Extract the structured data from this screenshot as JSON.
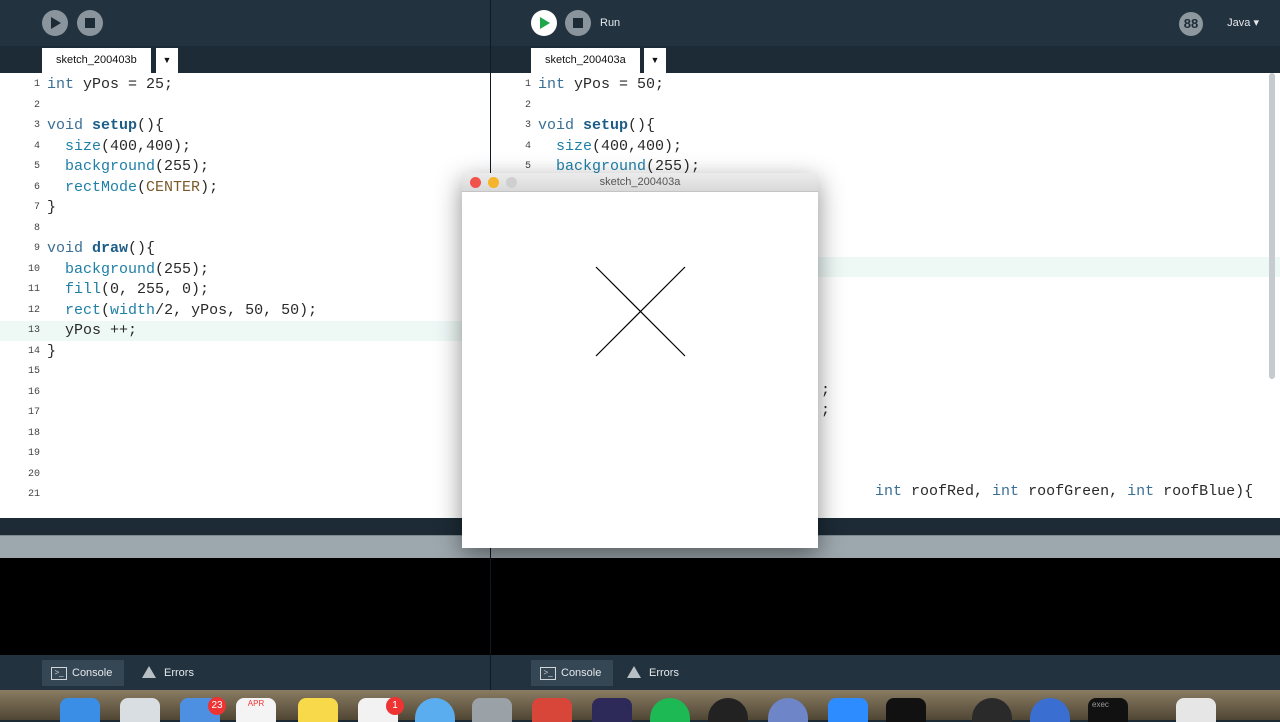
{
  "left_window": {
    "tab_name": "sketch_200403b",
    "code": [
      {
        "n": "1",
        "text": "int yPos = 25;"
      },
      {
        "n": "2",
        "text": ""
      },
      {
        "n": "3",
        "text": "void setup(){"
      },
      {
        "n": "4",
        "text": "  size(400,400);"
      },
      {
        "n": "5",
        "text": "  background(255);"
      },
      {
        "n": "6",
        "text": "  rectMode(CENTER);"
      },
      {
        "n": "7",
        "text": "}"
      },
      {
        "n": "8",
        "text": ""
      },
      {
        "n": "9",
        "text": "void draw(){"
      },
      {
        "n": "10",
        "text": "  background(255);"
      },
      {
        "n": "11",
        "text": "  fill(0, 255, 0);"
      },
      {
        "n": "12",
        "text": "  rect(width/2, yPos, 50, 50);"
      },
      {
        "n": "13",
        "text": "  yPos ++;"
      },
      {
        "n": "14",
        "text": "}"
      },
      {
        "n": "15",
        "text": ""
      },
      {
        "n": "16",
        "text": ""
      },
      {
        "n": "17",
        "text": ""
      },
      {
        "n": "18",
        "text": ""
      },
      {
        "n": "19",
        "text": ""
      },
      {
        "n": "20",
        "text": ""
      },
      {
        "n": "21",
        "text": ""
      }
    ],
    "console_tab": "Console",
    "errors_tab": "Errors"
  },
  "right_window": {
    "run_label": "Run",
    "mode": "Java",
    "mode_icon": "88",
    "tab_name": "sketch_200403a",
    "code": [
      {
        "n": "1",
        "text": "int yPos = 50;"
      },
      {
        "n": "2",
        "text": ""
      },
      {
        "n": "3",
        "text": "void setup(){"
      },
      {
        "n": "4",
        "text": "  size(400,400);"
      },
      {
        "n": "5",
        "text": "  background(255);"
      }
    ],
    "hidden_fragments": [
      ";",
      ";",
      "int roofRed, int roofGreen, int roofBlue){"
    ],
    "console_tab": "Console",
    "errors_tab": "Errors"
  },
  "sketch_window": {
    "title": "sketch_200403a"
  },
  "dock": {
    "mail_badge": "23",
    "calendar_month": "APR",
    "reminders_badge": "1",
    "exec_label": "exec"
  },
  "colors": {
    "ide_bg": "#1c2b36",
    "editor_bg": "#ffffff",
    "run_green": "#1fa64a",
    "keyword": "#3a6f95"
  }
}
